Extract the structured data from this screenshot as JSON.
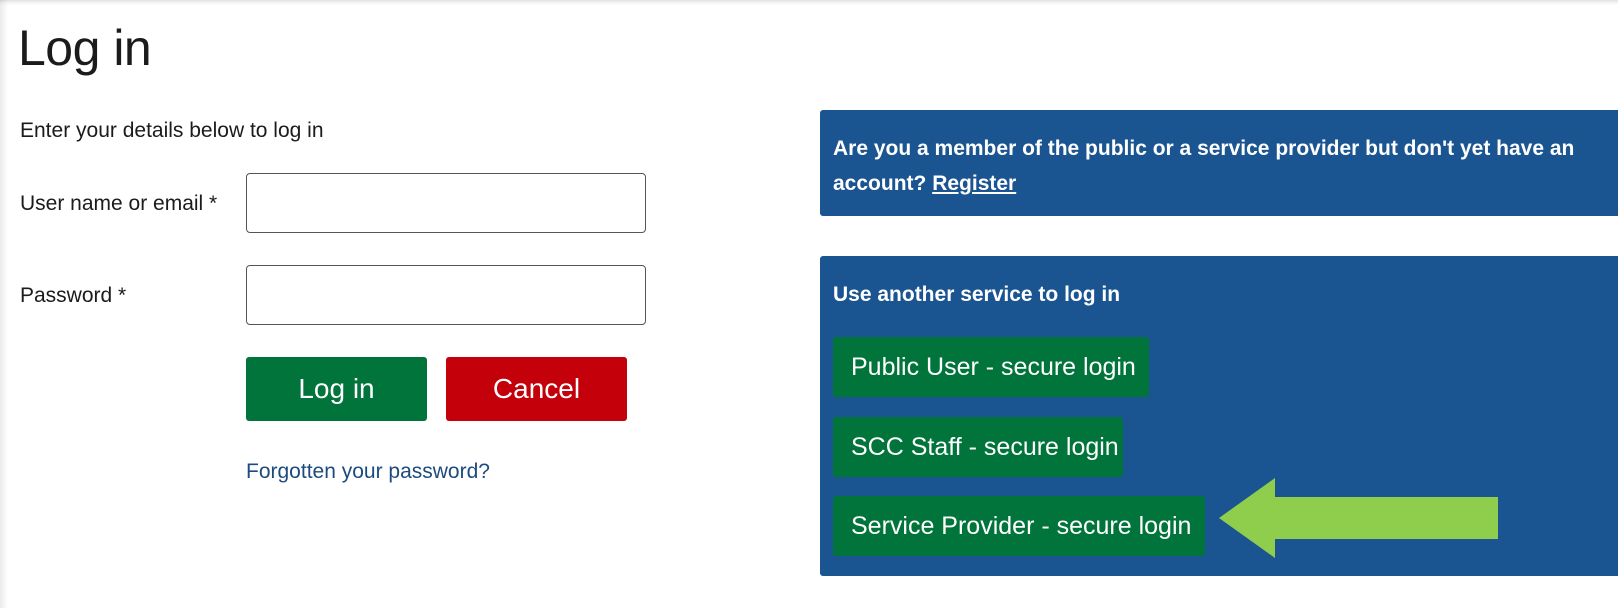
{
  "page": {
    "title": "Log in",
    "intro": "Enter your details below to log in"
  },
  "form": {
    "username_label": "User name or email *",
    "username_value": "",
    "password_label": "Password *",
    "password_value": "",
    "login_label": "Log in",
    "cancel_label": "Cancel",
    "forgot_label": "Forgotten your password?"
  },
  "register_panel": {
    "text": "Are you a member of the public or a service provider but don't yet have an account?",
    "link_label": "Register"
  },
  "services_panel": {
    "heading": "Use another service to log in",
    "buttons": [
      {
        "label": "Public User - secure login"
      },
      {
        "label": "SCC Staff - secure login"
      },
      {
        "label": "Service Provider - secure login"
      }
    ]
  },
  "annotation": {
    "arrow_icon": "left-arrow-icon",
    "arrow_color": "#8fce4c"
  },
  "colors": {
    "primary_green": "#00743a",
    "cancel_red": "#c4000b",
    "panel_blue": "#1b5591",
    "link_blue": "#1d4b7d"
  }
}
